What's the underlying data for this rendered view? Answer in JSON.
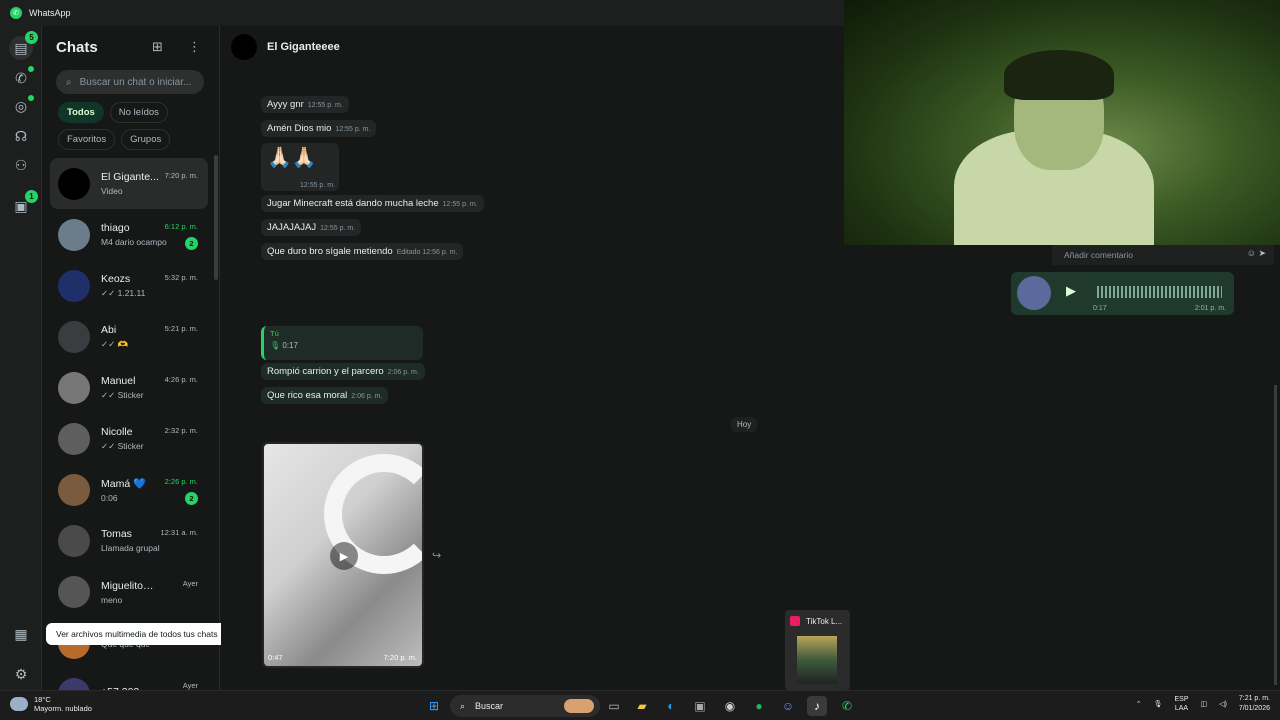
{
  "app": {
    "title": "WhatsApp"
  },
  "rail": {
    "chats_badge": "5",
    "status_badge": "1"
  },
  "chatlist": {
    "title": "Chats",
    "search_placeholder": "Buscar un chat o iniciar...",
    "filters": [
      "Todos",
      "No leídos",
      "Favoritos",
      "Grupos"
    ],
    "items": [
      {
        "name": "El Gigante...",
        "time": "7:20 p. m.",
        "sub": "Video",
        "sub_icon": "video-icon",
        "selected": true,
        "avatar_color": "#000000"
      },
      {
        "name": "thiago",
        "time": "6:12 p. m.",
        "sub": "M4 dario ocampo",
        "badge": "2",
        "time_green": true,
        "avatar_color": "#6b7d8a"
      },
      {
        "name": "Keozs",
        "time": "5:32 p. m.",
        "sub": "✓✓ 1.21.11",
        "avatar_color": "#1f2f6a"
      },
      {
        "name": "Abi",
        "time": "5:21 p. m.",
        "sub": "✓✓ 🫶",
        "avatar_color": "#3a3d3f"
      },
      {
        "name": "Manuel",
        "time": "4:26 p. m.",
        "sub": "✓✓ Sticker",
        "avatar_color": "#777777"
      },
      {
        "name": "Nicolle",
        "time": "2:32 p. m.",
        "sub": "✓✓ Sticker",
        "avatar_color": "#5e5e5e"
      },
      {
        "name": "Mamá 💙",
        "time": "2:26 p. m.",
        "sub": "0:06",
        "badge": "2",
        "time_green": true,
        "avatar_color": "#7a5b3e"
      },
      {
        "name": "Tomas",
        "time": "12:31 a. m.",
        "sub": "Llamada grupal",
        "avatar_color": "#4a4a4a"
      },
      {
        "name": "Miguelito🤘 ...",
        "time": "Ayer",
        "sub": "meno",
        "avatar_color": "#555555"
      },
      {
        "name": "",
        "time": "",
        "sub": "Que que que",
        "avatar_color": "#b86a2a"
      },
      {
        "name": "+57 302 ... (Tú)",
        "time": "Ayer",
        "sub": "",
        "avatar_color": "#3b3a6a"
      }
    ]
  },
  "tooltip": {
    "text": "Ver archivos multimedia de todos tus chats"
  },
  "conversation": {
    "name": "El Giganteeee",
    "messages": [
      {
        "text": "Ayyy gnr",
        "time": "12:55 p. m."
      },
      {
        "text": "Amén Dios mio",
        "time": "12:55 p. m."
      },
      {
        "text": "🙏🏻🙏🏻",
        "time": "12:55 p. m."
      },
      {
        "text": "Jugar Minecraft está dando mucha leche",
        "time": "12:55 p. m."
      },
      {
        "text": "JAJAJAJAJ",
        "time": "12:55 p. m."
      },
      {
        "text": "Que duro bro sígale metiendo",
        "time": "Editado 12:56 p. m."
      }
    ],
    "reply": {
      "author": "Tú",
      "audio": "0:17"
    },
    "messages2": [
      {
        "text": "Rompió carrion y el parcero",
        "time": "2:06 p. m."
      },
      {
        "text": "Que rico esa moral",
        "time": "2:06 p. m."
      }
    ],
    "date_separator": "Hoy",
    "video": {
      "duration": "0:47",
      "time": "7:20 p. m."
    }
  },
  "media_panel": {
    "comment_placeholder": "Añadir comentario",
    "voice": {
      "duration": "0:17",
      "time": "2:01 p. m."
    }
  },
  "taskbar": {
    "weather_temp": "18°C",
    "weather_desc": "Mayorm. nublado",
    "search": "Buscar",
    "preview_title": "TikTok L...",
    "lang_top": "ESP",
    "lang_bottom": "LAA",
    "time": "7:21 p. m.",
    "date": "7/01/2026"
  }
}
